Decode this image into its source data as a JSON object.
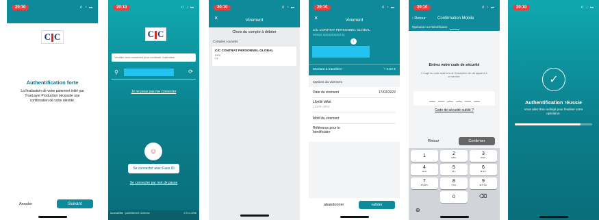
{
  "status_time": "20:10",
  "s1": {
    "logo": "CIC",
    "title": "Authentification forte",
    "body": "La finalisation de votre paiement initié par TrueLayer Production nécessite une confirmation de votre identité.",
    "cancel": "Annuler",
    "next": "Suivant"
  },
  "s2": {
    "logo": "CIC",
    "hint": "Veuillez vous connecter pour continuer l'opération.",
    "cant_connect": "Je ne peux pas me connecter",
    "faceid": "Se connecter avec Face ID",
    "password": "Se connecter par mot de passe",
    "footer_left": "Accessibilité : partiellement conforme",
    "footer_right": "9.72.0.3296"
  },
  "s3": {
    "header": "Virement",
    "choose": "Choix du compte à débiter",
    "section": "Comptes courants",
    "account_name": "C/C CONTRAT PERSONNEL GLOBAL",
    "account_num": "XXX"
  },
  "s4": {
    "header": "Virement",
    "account": "C/C CONTRAT PERSONNEL GLOBAL",
    "account_num": "XXXXX XXXXXXXXXX 01",
    "amount_label": "Montant à transférer",
    "amount": "+ 0,50 €",
    "options": "Options du virement",
    "date_label": "Date du virement",
    "date": "17/02/2022",
    "libelle": "Libellé débit",
    "libelle_ph": "Libellé débit",
    "motif": "Motif du virement",
    "reference": "Référence pour le bénéficiaire",
    "cancel": "abandonner",
    "validate": "valider"
  },
  "s5": {
    "back": "Retour",
    "header": "Confirmation Mobile",
    "sub": "Opération sur bénéficiaire",
    "title": "Entrez votre code de sécurité",
    "help": "Il s'agit du code saisi lors de l'inscription de cet appareil à ce service.",
    "forgot": "Code de sécurité oublié ?",
    "retour": "Retour",
    "confirm": "Confirmer",
    "keys": [
      {
        "n": "1",
        "l": ""
      },
      {
        "n": "2",
        "l": "ABC"
      },
      {
        "n": "3",
        "l": "DEF"
      },
      {
        "n": "4",
        "l": "GHI"
      },
      {
        "n": "5",
        "l": "JKL"
      },
      {
        "n": "6",
        "l": "MNO"
      },
      {
        "n": "7",
        "l": "PQRS"
      },
      {
        "n": "8",
        "l": "TUV"
      },
      {
        "n": "9",
        "l": "WXYZ"
      },
      {
        "n": "0",
        "l": ""
      }
    ]
  },
  "s6": {
    "title": "Authentification réussie",
    "body": "Vous allez être redirigé pour finaliser votre opération.",
    "progress": 0.85
  }
}
